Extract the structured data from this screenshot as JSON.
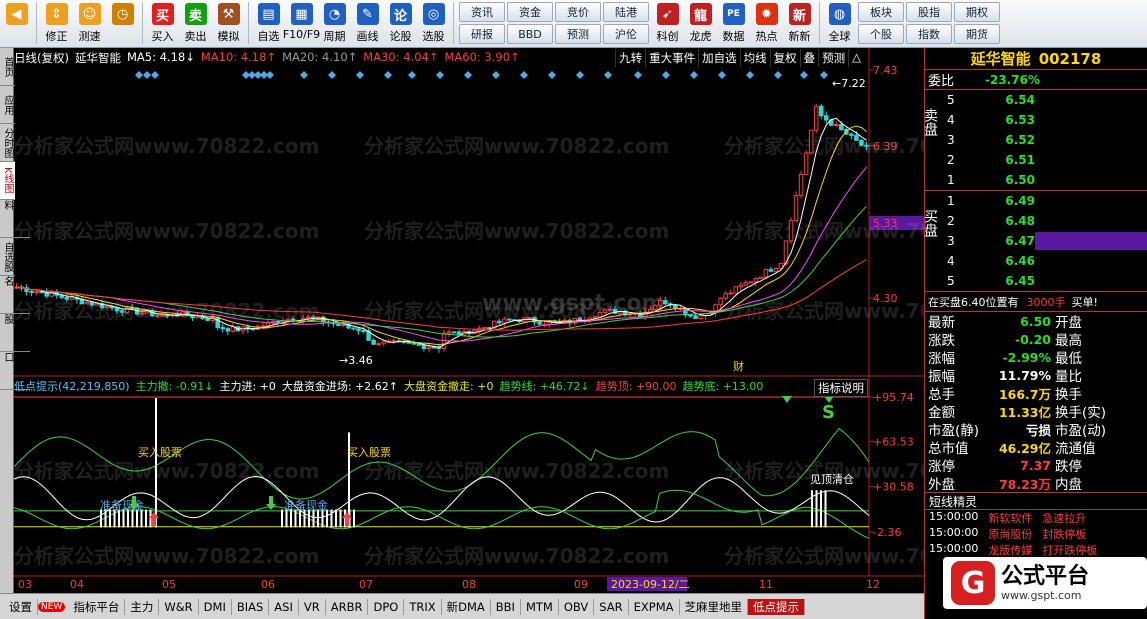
{
  "toolbar": {
    "buttons": [
      {
        "label": "",
        "icon": "back-arrow-icon",
        "color": "#f0a020"
      },
      {
        "label": "修正",
        "icon": "up-down-arrows-icon",
        "color": "#f0a020"
      },
      {
        "label": "测速",
        "icon": "bolt-icon",
        "color": "#f0a020"
      },
      {
        "label": "",
        "icon": "clock-icon",
        "color": "#d08000"
      },
      {
        "label": "买入",
        "icon": "buy-icon",
        "color": "#e02020",
        "glyph": "买"
      },
      {
        "label": "卖出",
        "icon": "sell-icon",
        "color": "#10a010",
        "glyph": "卖"
      },
      {
        "label": "模拟",
        "icon": "hammer-icon",
        "color": "#a05020"
      },
      {
        "label": "自选",
        "icon": "folder-icon",
        "color": "#2060c0"
      },
      {
        "label": "F10/F9",
        "icon": "f10-icon",
        "color": "#2060c0"
      },
      {
        "label": "周期",
        "icon": "clock-cycle-icon",
        "color": "#2060c0"
      },
      {
        "label": "画线",
        "icon": "pencil-icon",
        "color": "#2060c0"
      },
      {
        "label": "论股",
        "icon": "discuss-icon",
        "color": "#2060c0",
        "glyph": "论"
      },
      {
        "label": "选股",
        "icon": "stock-pick-icon",
        "color": "#2060c0"
      }
    ],
    "grid1": [
      "资讯",
      "资金",
      "竞价",
      "陆港",
      "研报",
      "BBD",
      "预测",
      "沪伦"
    ],
    "right_buttons": [
      {
        "label": "科创",
        "icon": "rocket-icon",
        "color": "#c02020"
      },
      {
        "label": "龙虎",
        "icon": "dragon-icon",
        "color": "#c02020"
      },
      {
        "label": "数据",
        "icon": "pe-icon",
        "color": "#2060c0",
        "glyph": "PE"
      },
      {
        "label": "热点",
        "icon": "hot-icon",
        "color": "#e03010"
      },
      {
        "label": "新新",
        "icon": "new-icon",
        "color": "#c02020",
        "glyph": "新"
      },
      {
        "label": "全球",
        "icon": "globe-icon",
        "color": "#2060c0"
      }
    ],
    "grid2": [
      "板块",
      "股指",
      "期权",
      "个股",
      "指数",
      "期货"
    ]
  },
  "left_tabs": [
    "首页",
    "应用",
    "分时图",
    "K线图",
    "个股资料",
    "自选股",
    "综合排名",
    "牛叉诊股",
    "超级盘口"
  ],
  "main": {
    "title_label": "日线(复权)",
    "stock_name": "延华智能",
    "ma5": "MA5: 4.18↓",
    "ma10": "MA10: 4.18↑",
    "ma20": "MA20: 4.10↑",
    "ma30": "MA30: 4.04↑",
    "ma60": "MA60: 3.90↑",
    "menu": [
      "九转",
      "重大事件",
      "加自选",
      "均线",
      "复权",
      "叠",
      "预测",
      "△"
    ],
    "price_labels": [
      "7.43",
      "6.39",
      "5.33",
      "4.30"
    ],
    "high_marker": "7.22",
    "low_marker": "3.46",
    "cai_marker": "财",
    "watermark": "分析家公式网www.70822.com",
    "watermark2": "www.gspt.com"
  },
  "indicator": {
    "name": "低点提示(42,219,850)",
    "zhuli": "主力撤: -0.91↓",
    "zhuli_in": "主力进: +0",
    "dapan_in": "大盘资金进场: +2.62↑",
    "dapan_out": "大盘资金撤走: +0",
    "trend_line": "趋势线: +46.72↓",
    "trend_top": "趋势顶: +90.00",
    "trend_bottom": "趋势底: +13.00",
    "button": "指标说明",
    "ylabels": [
      "+95.74",
      "+63.53",
      "+30.58",
      "-2.36"
    ],
    "annotations": [
      "买入股票",
      "买入股票",
      "准备现金",
      "准备现金",
      "见顶清仓",
      "S"
    ]
  },
  "dates": [
    "03",
    "04",
    "05",
    "06",
    "07",
    "08",
    "09",
    "10",
    "11",
    "12"
  ],
  "date_highlight": "2023-09-12/二",
  "bottom_tabs": [
    "设置",
    "NEW",
    "指标平台",
    "主力",
    "W&R",
    "DMI",
    "BIAS",
    "ASI",
    "VR",
    "ARBR",
    "DPO",
    "TRIX",
    "新DMA",
    "BBI",
    "MTM",
    "OBV",
    "SAR",
    "EXPMA",
    "芝麻里地里",
    "低点提示"
  ],
  "right": {
    "stock_name": "延华智能",
    "code": "002178",
    "weibi_label": "委比",
    "weibi_value": "-23.76%",
    "sell_label": "卖盘",
    "buy_label": "买盘",
    "sells": [
      {
        "n": "5",
        "p": "6.54"
      },
      {
        "n": "4",
        "p": "6.53"
      },
      {
        "n": "3",
        "p": "6.52"
      },
      {
        "n": "2",
        "p": "6.51"
      },
      {
        "n": "1",
        "p": "6.50"
      }
    ],
    "buys": [
      {
        "n": "1",
        "p": "6.49"
      },
      {
        "n": "2",
        "p": "6.48"
      },
      {
        "n": "3",
        "p": "6.47"
      },
      {
        "n": "4",
        "p": "6.46"
      },
      {
        "n": "5",
        "p": "6.45"
      }
    ],
    "order_note": "在买盘6.40位置有",
    "order_vol": "3000手",
    "order_tag": "买单!",
    "quotes": [
      {
        "k": "最新",
        "v": "6.50",
        "vc": "#27e027",
        "k2": "开盘"
      },
      {
        "k": "涨跌",
        "v": "-0.20",
        "vc": "#27e027",
        "k2": "最高"
      },
      {
        "k": "涨幅",
        "v": "-2.99%",
        "vc": "#27e027",
        "k2": "最低"
      },
      {
        "k": "振幅",
        "v": "11.79%",
        "vc": "#fff",
        "k2": "量比"
      },
      {
        "k": "总手",
        "v": "166.7万",
        "vc": "#ffd800",
        "k2": "换手"
      },
      {
        "k": "金额",
        "v": "11.33亿",
        "vc": "#ffd800",
        "k2": "换手(实)"
      },
      {
        "k": "市盈(静)",
        "v": "亏损",
        "vc": "#fff",
        "k2": "市盈(动)"
      },
      {
        "k": "总市值",
        "v": "46.29亿",
        "vc": "#ffd800",
        "k2": "流通值"
      },
      {
        "k": "涨停",
        "v": "7.37",
        "vc": "#ff3b3b",
        "k2": "跌停"
      },
      {
        "k": "外盘",
        "v": "78.23万",
        "vc": "#ff3b3b",
        "k2": "内盘"
      }
    ],
    "short_title": "短线精灵",
    "short_rows": [
      {
        "t": "15:00:00",
        "a": "新软软件",
        "b": "急速拉升"
      },
      {
        "t": "15:00:00",
        "a": "原尚股份",
        "b": "封跌停板"
      },
      {
        "t": "15:00:00",
        "a": "龙版传媒",
        "b": "打开跌停板"
      }
    ]
  },
  "logo": {
    "title": "公式平台",
    "url": "www.gspt.com"
  }
}
